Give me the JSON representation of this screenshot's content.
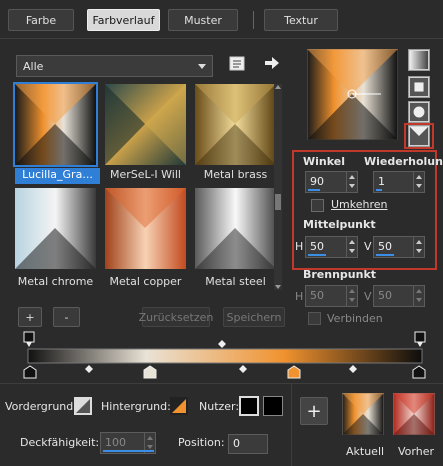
{
  "tabs": [
    {
      "label": "Farbe",
      "active": false
    },
    {
      "label": "Farbverlauf",
      "active": true
    },
    {
      "label": "Muster",
      "active": false
    },
    {
      "label": "Textur",
      "active": false
    }
  ],
  "gradient_list": {
    "dropdown_value": "Alle",
    "items": [
      {
        "label": "Lucilla_Gra...",
        "selected": true
      },
      {
        "label": "MerSeL-I Will",
        "selected": false
      },
      {
        "label": "Metal brass",
        "selected": false
      },
      {
        "label": "Metal chrome",
        "selected": false
      },
      {
        "label": "Metal copper",
        "selected": false
      },
      {
        "label": "Metal steel",
        "selected": false
      }
    ],
    "add_label": "+",
    "remove_label": "-",
    "reset_label": "Zurücksetzen",
    "save_label": "Speichern"
  },
  "settings": {
    "angle_label": "Winkel",
    "angle_value": "90",
    "repeat_label": "Wiederholung",
    "repeat_value": "1",
    "invert_label": "Umkehren",
    "center_label": "Mittelpunkt",
    "center_h_label": "H",
    "center_h_value": "50",
    "center_v_label": "V",
    "center_v_value": "50",
    "focus_label": "Brennpunkt",
    "focus_h_label": "H",
    "focus_h_value": "50",
    "focus_v_label": "V",
    "focus_v_value": "50",
    "link_label": "Verbinden"
  },
  "bottom": {
    "foreground_label": "Vordergrund:",
    "background_label": "Hintergrund:",
    "user_label": "Nutzer:",
    "opacity_label": "Deckfähigkeit:",
    "opacity_value": "100",
    "position_label": "Position:",
    "position_value": "0",
    "add_label": "+",
    "current_label": "Aktuell",
    "previous_label": "Vorher"
  },
  "colors": {
    "accent_blue": "#2f7fd6",
    "highlight_red": "#c0392b",
    "orange": "#f0922e"
  }
}
